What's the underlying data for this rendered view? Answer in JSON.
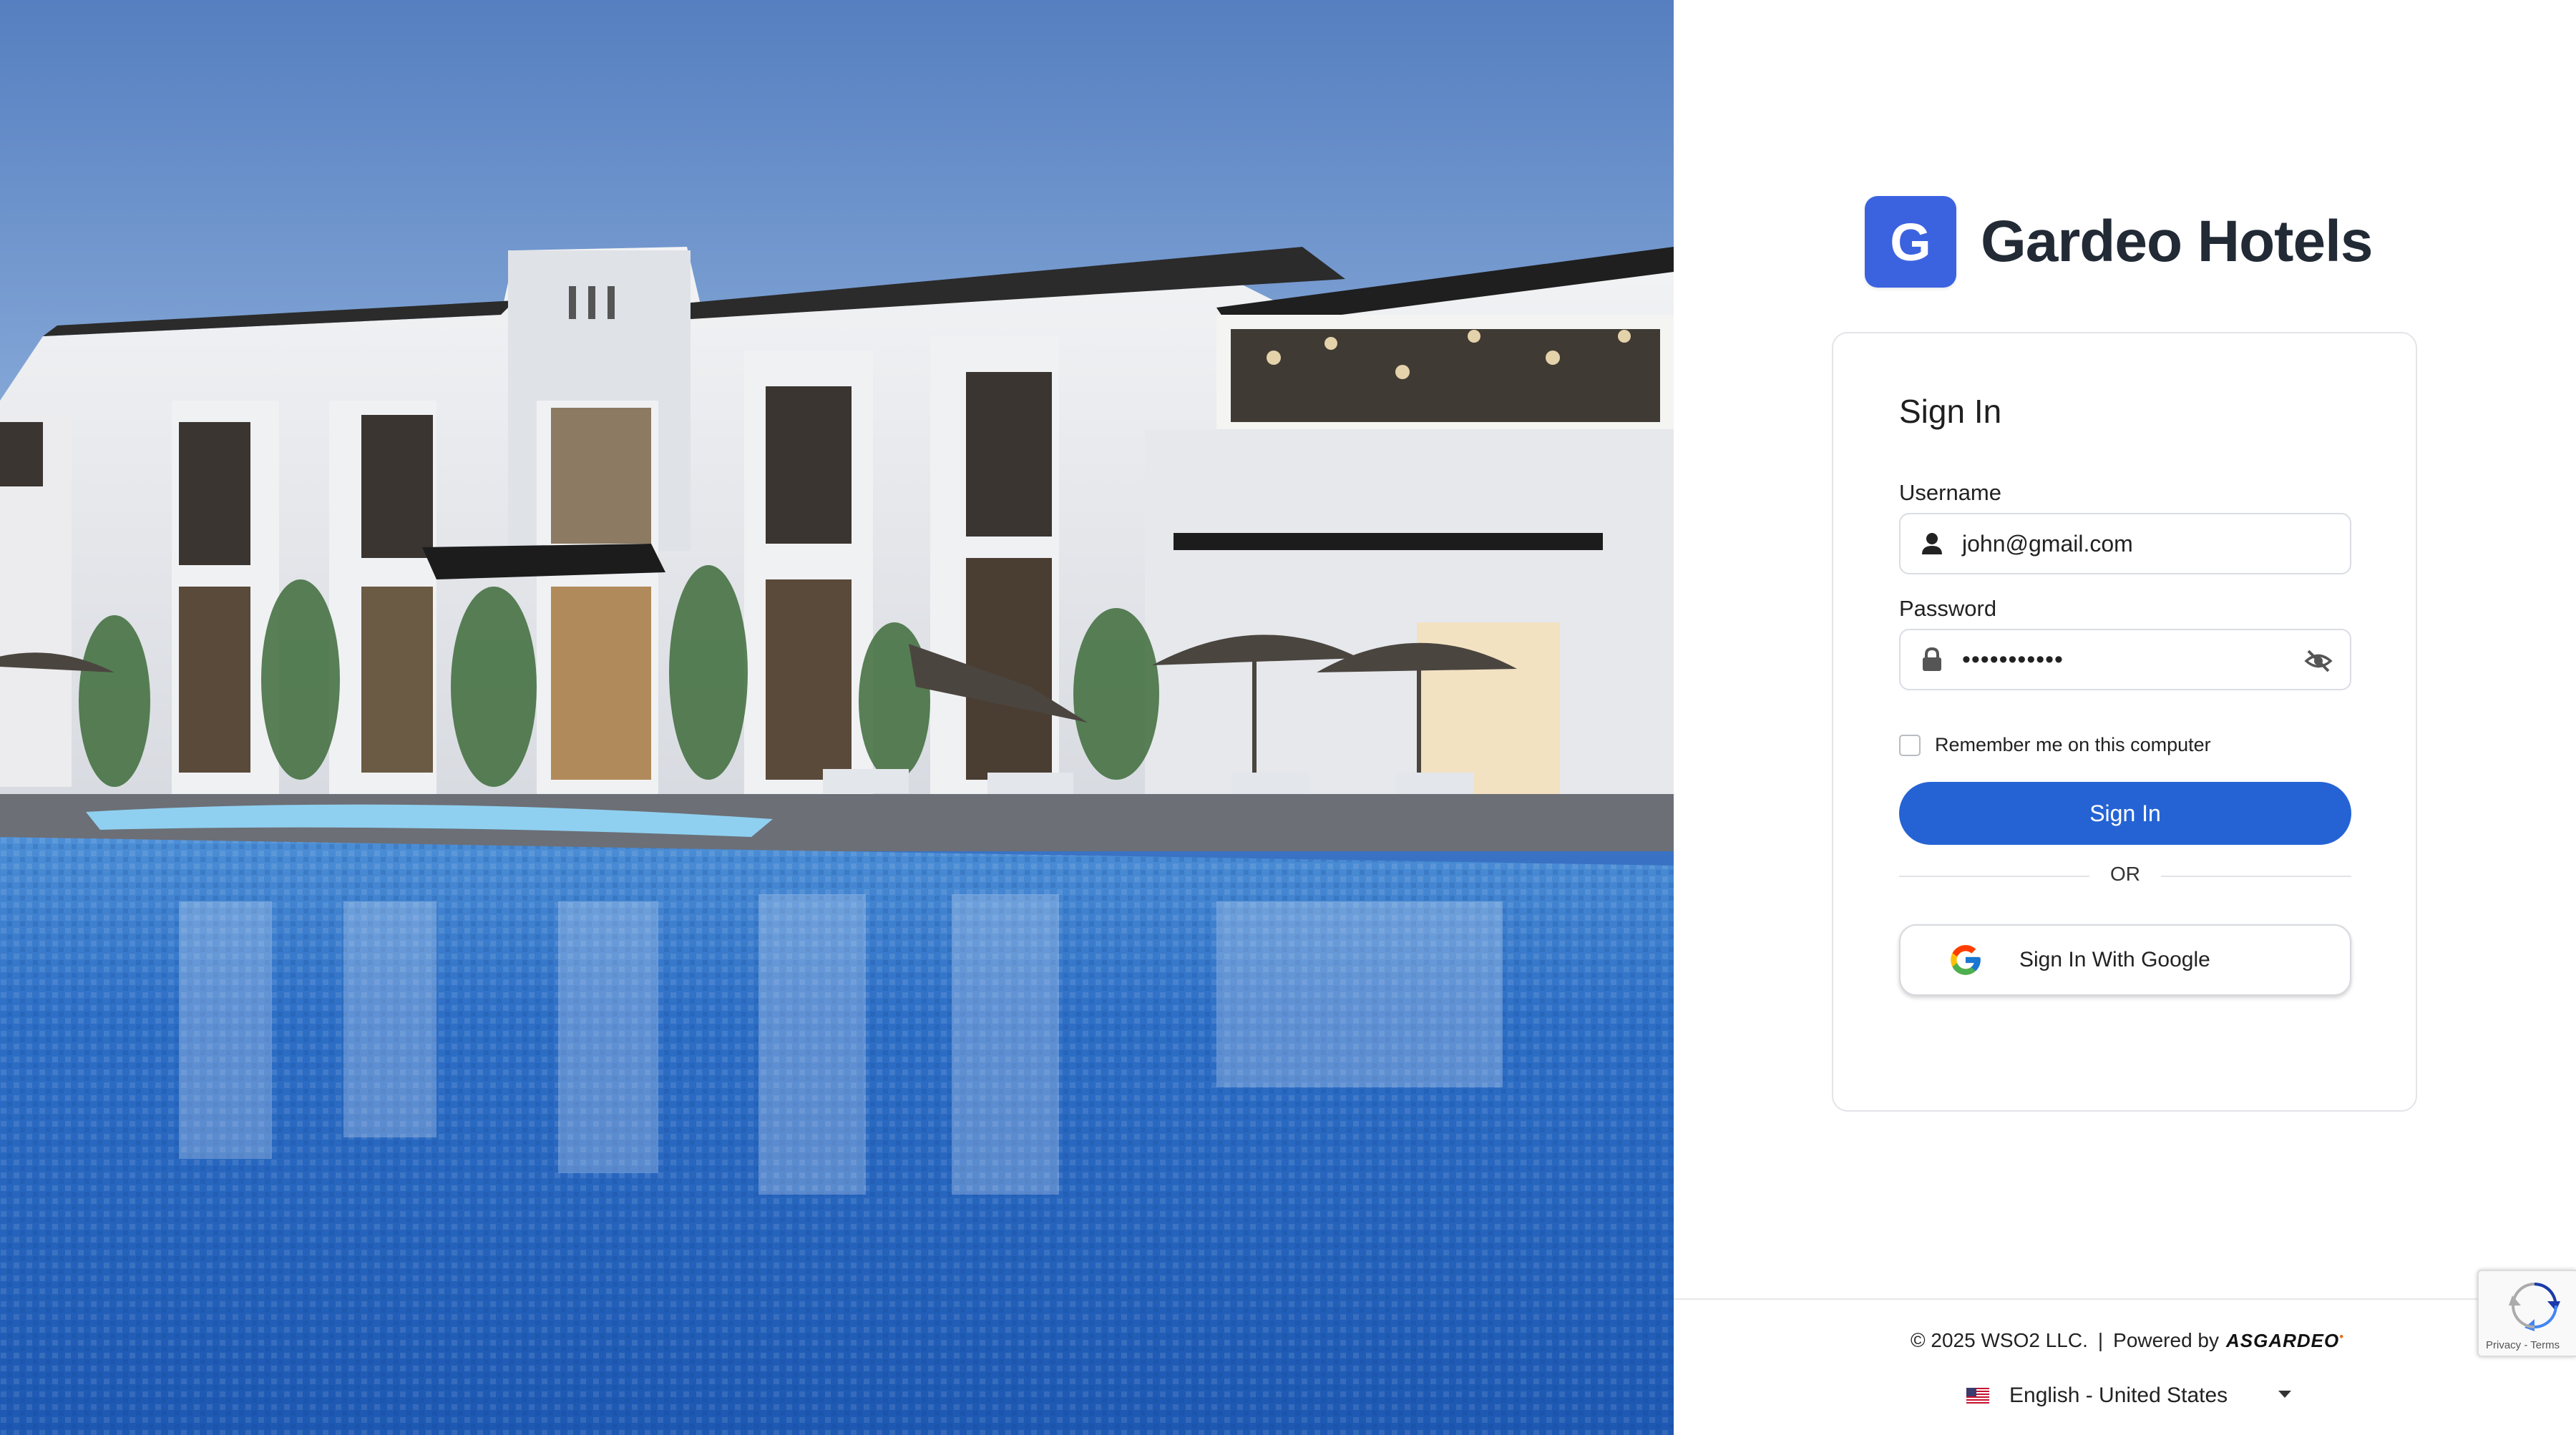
{
  "hero": {
    "image": "hotel pool exterior at dusk"
  },
  "brand": {
    "logo_letter": "G",
    "name": "Gardeo Hotels",
    "accent": "#3B63E0"
  },
  "signin": {
    "title": "Sign In",
    "username": {
      "label": "Username",
      "value": "john@gmail.com",
      "icon": "user-icon"
    },
    "password": {
      "label": "Password",
      "value": "•••••••••••",
      "icon": "lock-icon",
      "toggle_icon": "eye-slash-icon"
    },
    "remember_label": "Remember me on this computer",
    "remember_checked": false,
    "submit_label": "Sign In",
    "submit_color": "#2563D4",
    "divider_text": "OR",
    "google_label": "Sign In With Google"
  },
  "footer": {
    "copyright": "© 2025 WSO2 LLC.",
    "separator": "|",
    "powered_by": "Powered by",
    "powered_logo": "ASGARDEO",
    "language": "English - United States",
    "language_flag": "us-flag-icon"
  },
  "recaptcha": {
    "privacy": "Privacy",
    "dash": "-",
    "terms": "Terms"
  }
}
